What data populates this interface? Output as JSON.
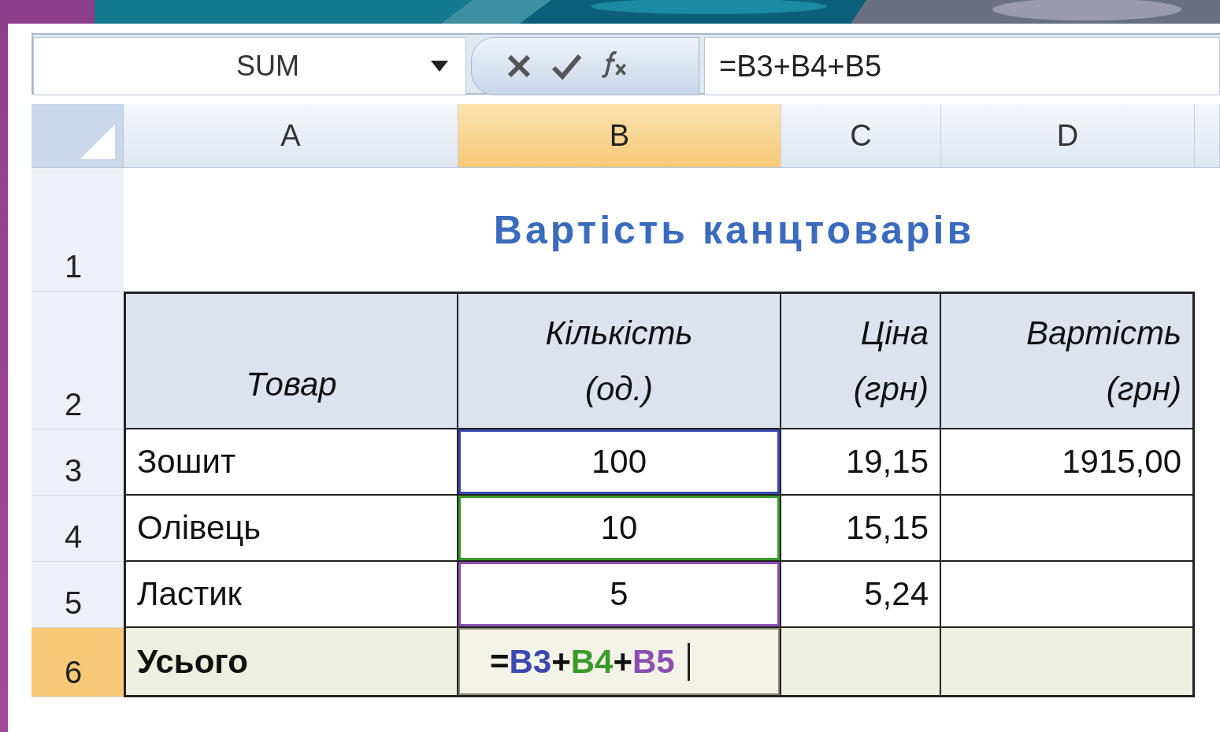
{
  "formula_bar": {
    "name_box": "SUM",
    "formula": "=B3+B4+B5"
  },
  "columns": [
    {
      "label": "A",
      "selected": false
    },
    {
      "label": "B",
      "selected": true
    },
    {
      "label": "C",
      "selected": false
    },
    {
      "label": "D",
      "selected": false
    }
  ],
  "rows": [
    {
      "label": "1",
      "selected": false,
      "kind": "title",
      "title": "Вартість канцтоварів"
    },
    {
      "label": "2",
      "selected": false,
      "kind": "header",
      "cells": [
        {
          "text": "Товар"
        },
        {
          "text": "Кількість\n(од.)"
        },
        {
          "text": "Ціна\n(грн)"
        },
        {
          "text": "Вартість\n(грн)"
        }
      ]
    },
    {
      "label": "3",
      "selected": false,
      "kind": "data",
      "cells": [
        {
          "text": "Зошит"
        },
        {
          "text": "100",
          "color": "#3b48b0"
        },
        {
          "text": "19,15"
        },
        {
          "text": "1915,00"
        }
      ]
    },
    {
      "label": "4",
      "selected": false,
      "kind": "data",
      "cells": [
        {
          "text": "Олівець"
        },
        {
          "text": "10",
          "color": "#3a9a2a"
        },
        {
          "text": "15,15"
        },
        {}
      ]
    },
    {
      "label": "5",
      "selected": false,
      "kind": "data",
      "cells": [
        {
          "text": "Ластик"
        },
        {
          "text": "5",
          "color": "#8a4fb0"
        },
        {
          "text": "5,24"
        },
        {}
      ]
    },
    {
      "label": "6",
      "selected": true,
      "kind": "total",
      "cells": [
        {
          "text": "Усього"
        },
        {
          "editing": true,
          "parts": [
            {
              "text": "=",
              "color": "#111111"
            },
            {
              "text": "B3",
              "color": "#3b48b0"
            },
            {
              "text": "+",
              "color": "#111111"
            },
            {
              "text": "B4",
              "color": "#3a9a2a"
            },
            {
              "text": "+",
              "color": "#111111"
            },
            {
              "text": "B5",
              "color": "#8a4fb0"
            }
          ]
        },
        {},
        {}
      ]
    }
  ]
}
